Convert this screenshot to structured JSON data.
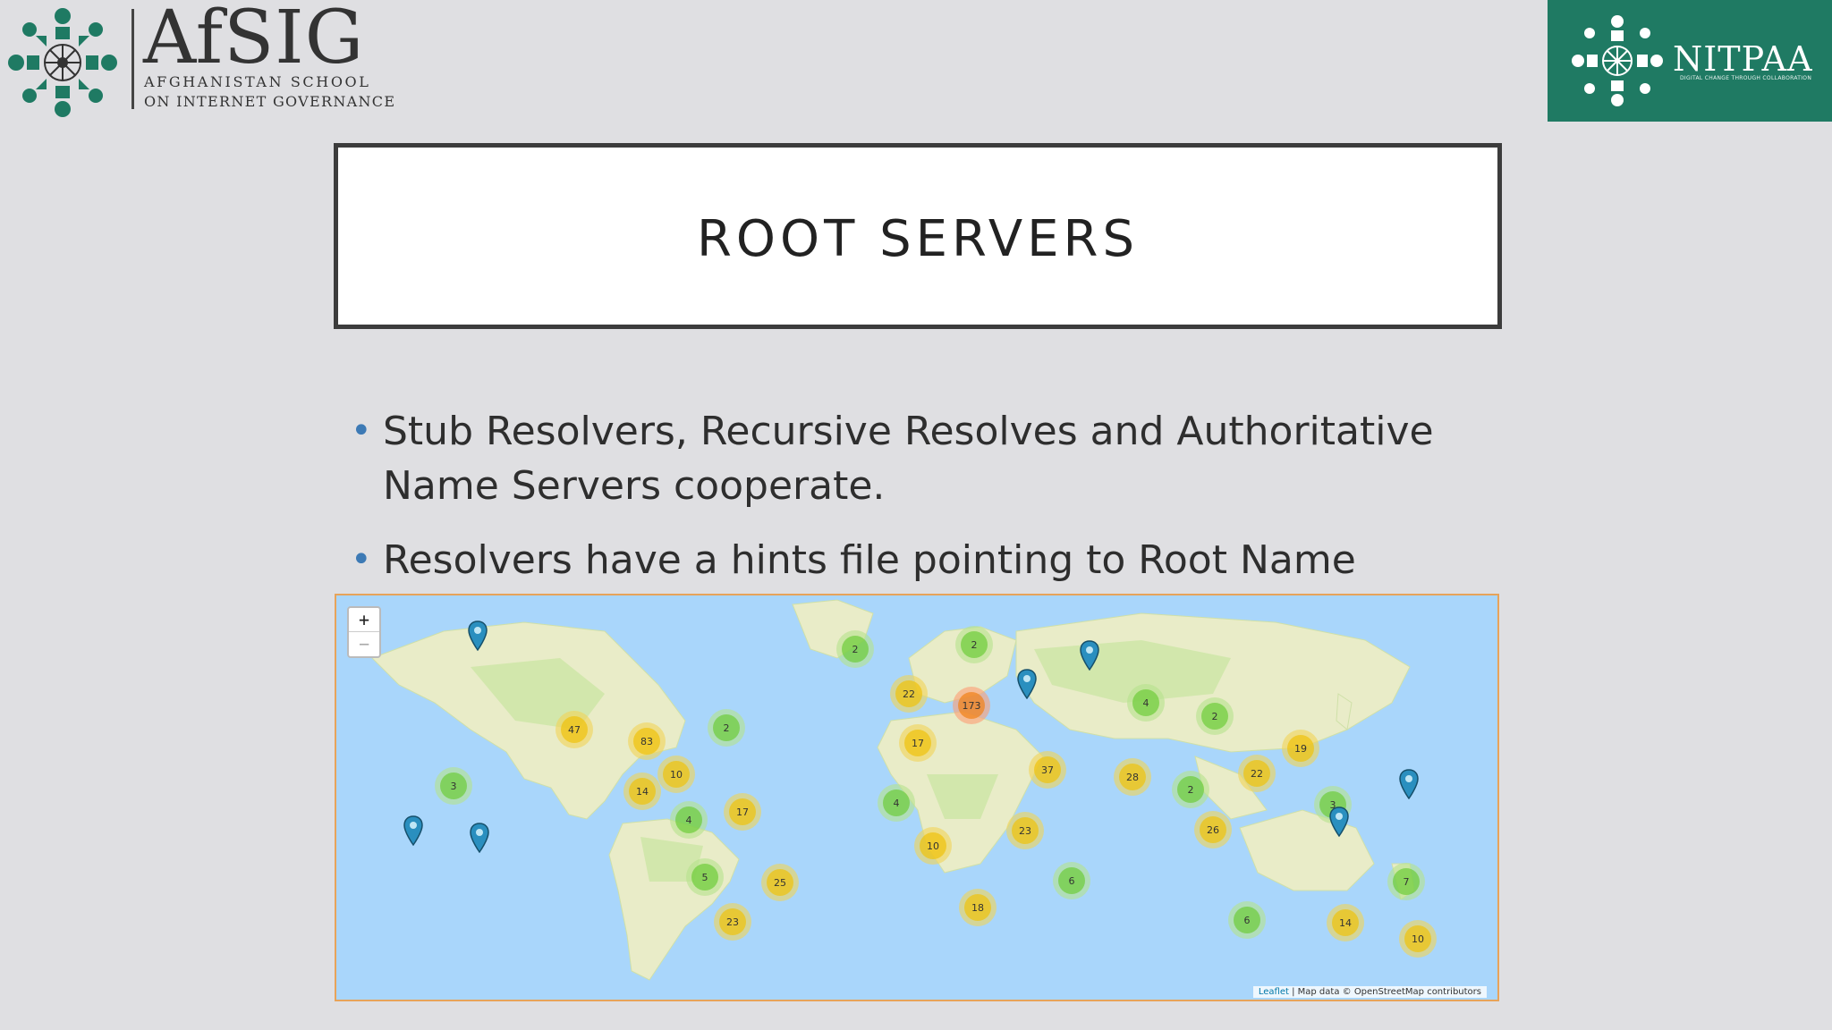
{
  "header": {
    "afsig": {
      "name": "AfSIG",
      "line1": "AFGHANISTAN SCHOOL",
      "line2": "ON INTERNET GOVERNANCE"
    },
    "nitpaa": {
      "name": "NITPAA",
      "tagline": "DIGITAL CHANGE THROUGH COLLABORATION"
    }
  },
  "slide": {
    "title": "ROOT SERVERS",
    "bullets": [
      {
        "text": "Stub Resolvers, Recursive Resolves and Authoritative Name Servers cooperate."
      },
      {
        "text": "Resolvers have a hints file pointing to Root Name Servers."
      }
    ]
  },
  "map": {
    "zoom_in": "+",
    "zoom_out": "−",
    "attribution_leaflet": "Leaflet",
    "attribution_text": " | Map data © OpenStreetMap contributors",
    "clusters": [
      "2",
      "2",
      "22",
      "173",
      "4",
      "2",
      "47",
      "83",
      "2",
      "17",
      "19",
      "10",
      "37",
      "28",
      "22",
      "3",
      "14",
      "2",
      "3",
      "4",
      "17",
      "4",
      "10",
      "23",
      "26",
      "5",
      "25",
      "6",
      "7",
      "23",
      "18",
      "6",
      "14",
      "10"
    ]
  },
  "colors": {
    "nitpaa_green": "#1f7a63",
    "afsig_green": "#1f7a63",
    "bullet_dot": "#3d7ab5",
    "map_ocean": "#a9d6fb",
    "map_frame": "#e7a35a"
  }
}
